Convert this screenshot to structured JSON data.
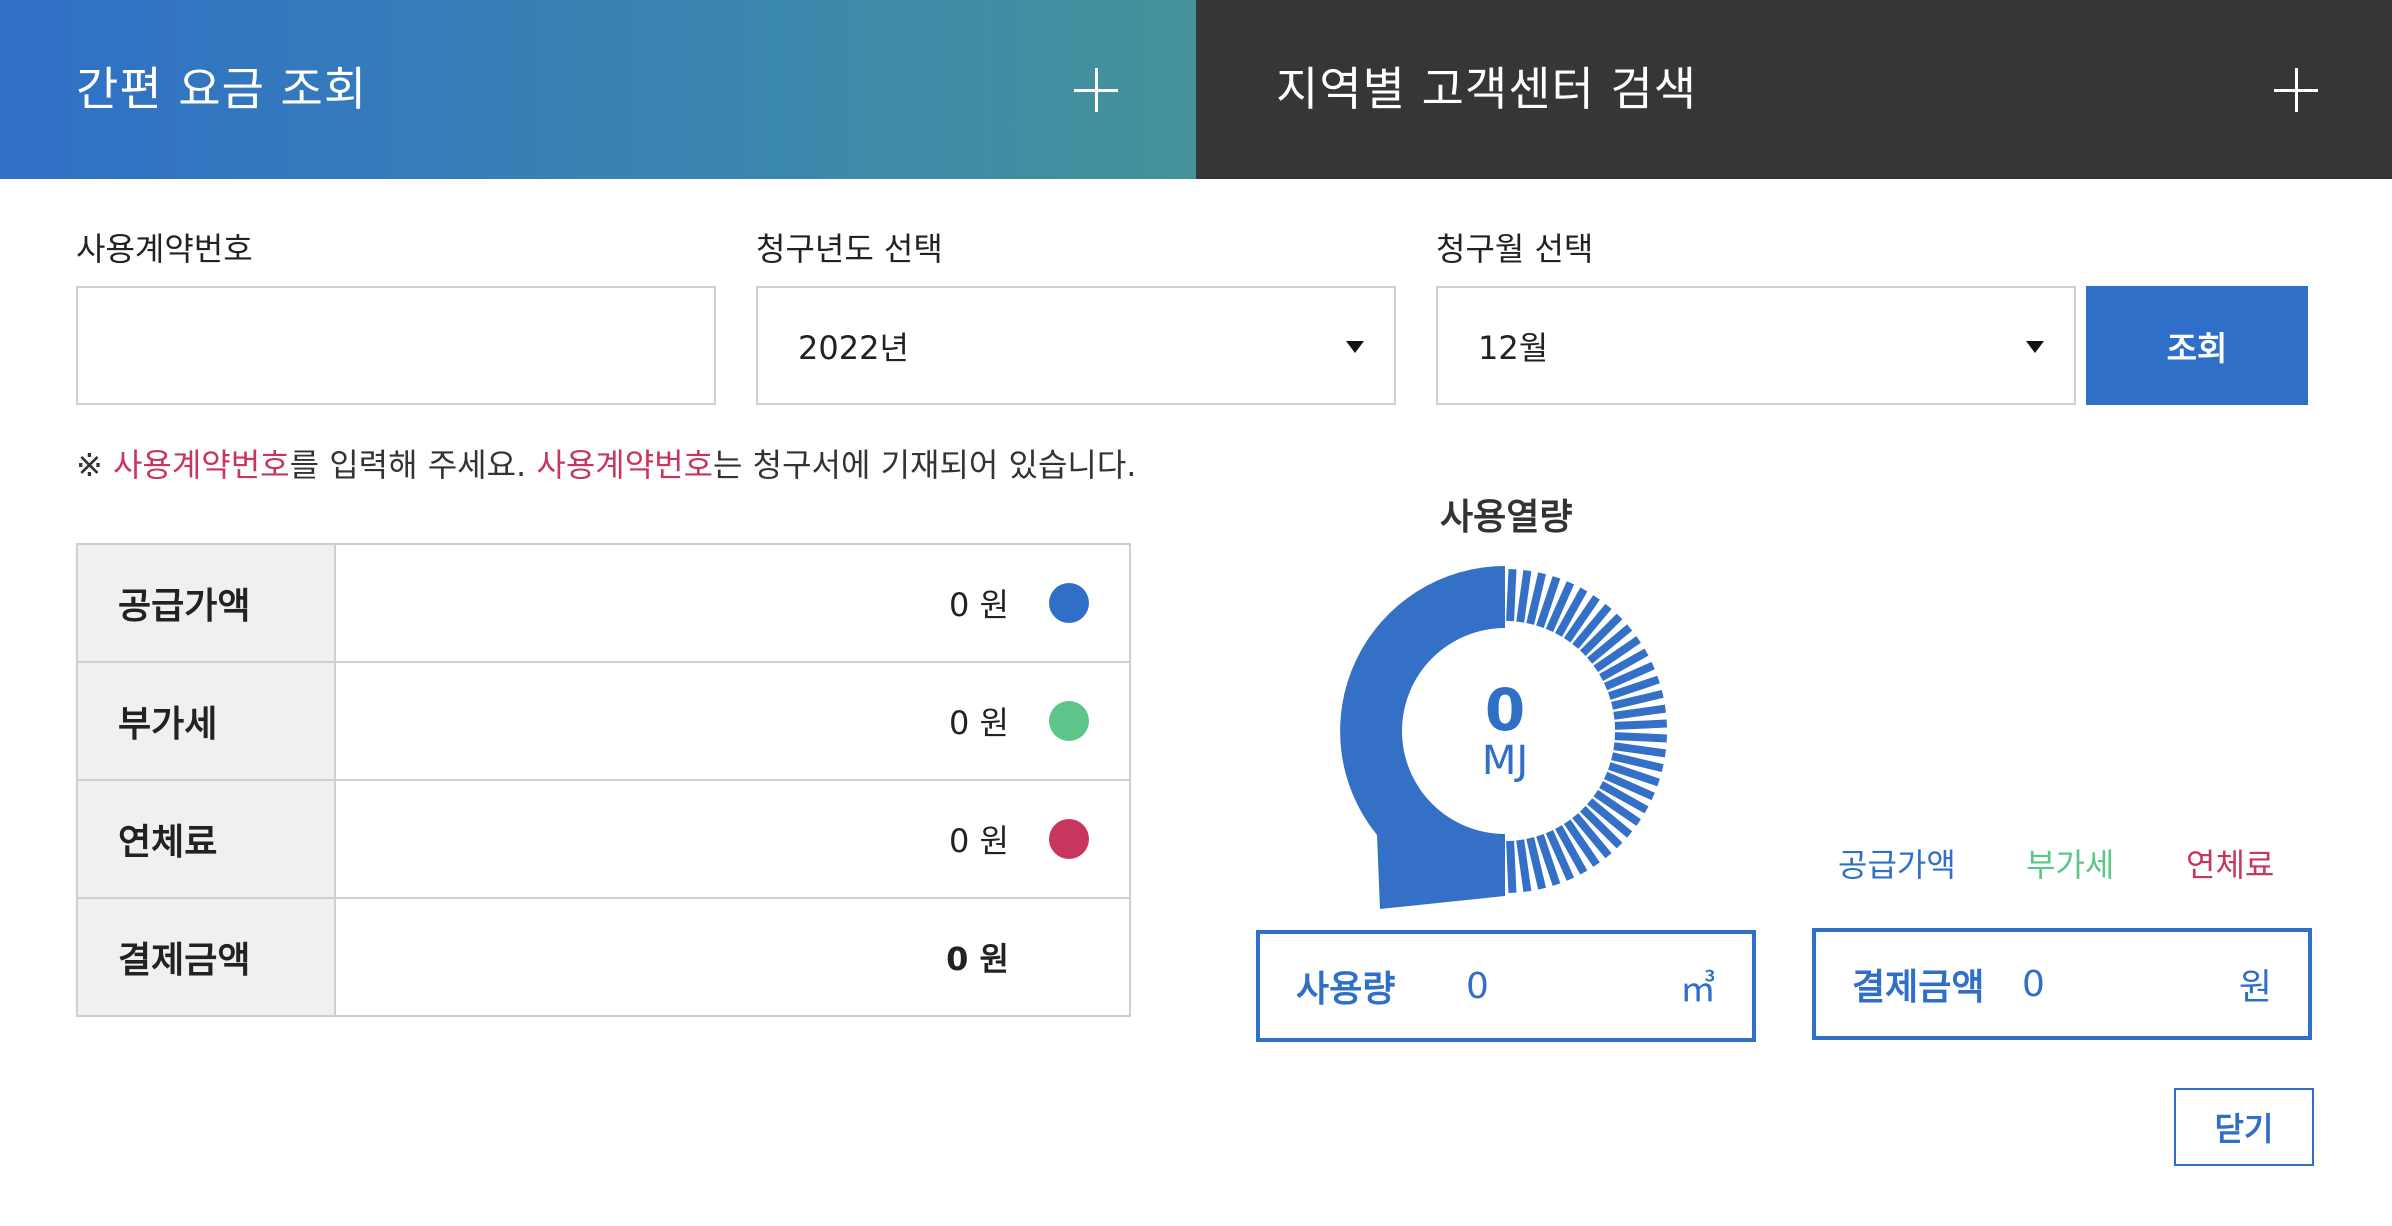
{
  "header": {
    "left_title": "간편 요금 조회",
    "right_title": "지역별 고객센터 검색"
  },
  "form": {
    "contract_label": "사용계약번호",
    "contract_value": "",
    "year_label": "청구년도 선택",
    "year_value": "2022년",
    "month_label": "청구월 선택",
    "month_value": "12월",
    "search_label": "조회"
  },
  "notice": {
    "prefix": "※ ",
    "term1": "사용계약번호",
    "mid": "를 입력해 주세요. ",
    "term2": "사용계약번호",
    "suffix": "는 청구서에 기재되어 있습니다."
  },
  "bill_table": {
    "rows": [
      {
        "label": "공급가액",
        "value": "0 원",
        "dot_color": "#2f6fc7"
      },
      {
        "label": "부가세",
        "value": "0 원",
        "dot_color": "#5dc48a"
      },
      {
        "label": "연체료",
        "value": "0 원",
        "dot_color": "#c8365d"
      },
      {
        "label": "결제금액",
        "value": "0 원"
      }
    ]
  },
  "usage_chart": {
    "title": "사용열량",
    "value": "0",
    "unit": "MJ"
  },
  "legend": {
    "supply": "공급가액",
    "supply_color": "#2f6fc7",
    "vat": "부가세",
    "vat_color": "#5dc48a",
    "late": "연체료",
    "late_color": "#c8365d"
  },
  "usage_box": {
    "label": "사용량",
    "value": "0",
    "unit": "㎥"
  },
  "payment_box": {
    "label": "결제금액",
    "value": "0",
    "unit": "원"
  },
  "close_label": "닫기"
}
